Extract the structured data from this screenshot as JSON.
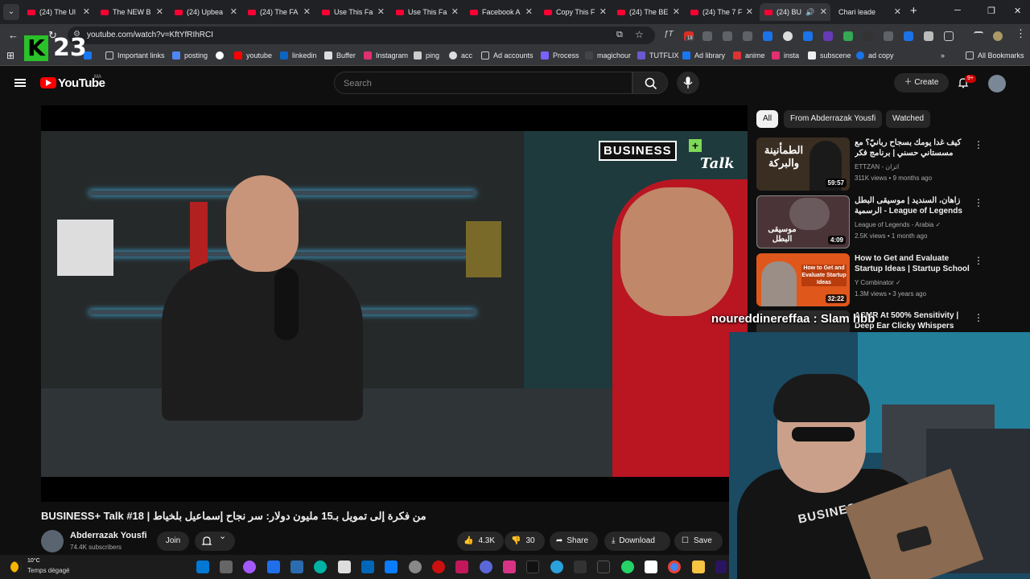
{
  "browser": {
    "tabs": [
      {
        "label": "(24) The Ul",
        "youtube": true
      },
      {
        "label": "The NEW B",
        "youtube": true
      },
      {
        "label": "(24) Upbea",
        "youtube": true
      },
      {
        "label": "(24) The FA",
        "youtube": true
      },
      {
        "label": "Use This Fa",
        "youtube": true
      },
      {
        "label": "Use This Fa",
        "youtube": true
      },
      {
        "label": "Facebook A",
        "youtube": true
      },
      {
        "label": "Copy This F",
        "youtube": true
      },
      {
        "label": "(24) The BE",
        "youtube": true
      },
      {
        "label": "(24) The 7 F",
        "youtube": true
      },
      {
        "label": "(24) BU",
        "youtube": true
      },
      {
        "label": "Chari leade",
        "youtube": false
      }
    ],
    "url": "youtube.com/watch?v=KftYfRIhRCI",
    "extension_badge": "18",
    "bookmarks": [
      "Important links",
      "posting",
      "youtube",
      "linkedin",
      "Buffer",
      "Instagram",
      "ping",
      "acc",
      "Ad accounts",
      "Process",
      "magichour",
      "TUTFLIX",
      "Ad library",
      "anime",
      "insta",
      "subscene",
      "ad copy"
    ],
    "all_bookmarks": "All Bookmarks"
  },
  "overlay": {
    "logo_letter": "K",
    "logo_number": "23",
    "chat_message": "noureddinereffaa : Slam hbb"
  },
  "youtube": {
    "brand": "YouTube",
    "country": "MA",
    "search_placeholder": "Search",
    "create_label": "Create",
    "notif_badge": "9+",
    "video": {
      "title": "BUSINESS+ Talk #18 | من فكرة إلى تمويل بـ15 مليون دولار: سر نجاح إسماعيل بلخياط",
      "logo_text": "BUSINESS",
      "logo_talk": "Talk",
      "channel": "Abderrazak Yousfi",
      "subscribers": "74.4K subscribers",
      "join_label": "Join",
      "likes": "4.3K",
      "dislikes": "30",
      "share_label": "Share",
      "download_label": "Download",
      "save_label": "Save"
    },
    "chips": [
      "All",
      "From Abderrazak Yousfi",
      "Watched"
    ],
    "related": [
      {
        "title": "كيف غدا يومك بسجاح ربانيّ؟ مع مسستاني حسني | برنامج فكر",
        "channel": "ETTZAN - اتزان",
        "meta": "311K views • 9 months ago",
        "duration": "59:57",
        "thumb_text": "الطمأنينة والبركة",
        "color": "#3a2e22"
      },
      {
        "title": "زاهان، السنديد | موسيقى البطل الرسمية - League of Legends",
        "channel": "League of Legends - Arabia",
        "meta": "2.5K views • 1 month ago",
        "duration": "4:09",
        "thumb_text": "موسيقى البطل",
        "color": "#4a3438"
      },
      {
        "title": "How to Get and Evaluate Startup Ideas | Startup School",
        "channel": "Y Combinator",
        "meta": "1.3M views • 3 years ago",
        "duration": "32:22",
        "thumb_text": "How to Get and Evaluate Startup Ideas",
        "color": "#e0571b"
      },
      {
        "title": "ASMR At 500% Sensitivity | Deep Ear Clicky Whispers",
        "channel": "",
        "meta": "",
        "duration": "",
        "thumb_text": "",
        "color": "#2b2b2b"
      }
    ]
  },
  "webcam": {
    "shirt_text": "BUSINESS+"
  },
  "taskbar": {
    "temperature": "10°C",
    "condition": "Temps dégagé"
  }
}
